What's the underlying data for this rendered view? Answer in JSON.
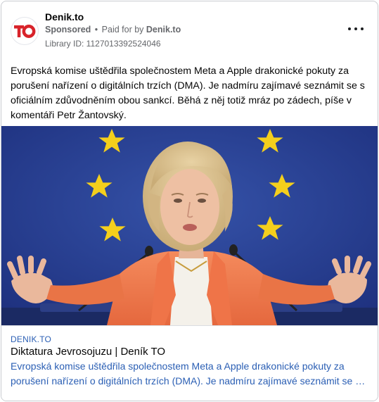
{
  "post": {
    "page_name": "Denik.to",
    "avatar_logo_text": "TO",
    "sponsored_label": "Sponsored",
    "separator": "•",
    "paid_for_prefix": "Paid for by",
    "paid_for_by": "Denik.to",
    "library_id": "Library ID: 1127013392524046",
    "text": "Evropská komise uštědřila společnostem Meta a Apple drakonické pokuty za porušení nařízení o digitálních trzích (DMA). Je nadmíru zajímavé seznámit se s oficiálním zdůvodněním obou sankcí. Běhá z něj totiž mráz po zádech, píše v komentáři Petr Žantovský."
  },
  "link_preview": {
    "domain": "DENIK.TO",
    "title": "Diktatura Jevrosojuzu | Deník TO",
    "description": "Evropská komise uštědřila společnostem Meta a Apple drakonické pokuty za porušení nařízení o digitálních trzích (DMA). Je nadmíru zajímavé seznámit se s oficiálním zdůvodněním obou sankcí."
  },
  "icons": {
    "avatar": "denik-to-logo",
    "more": "more-options-icon"
  },
  "colors": {
    "brand_red": "#d8232a",
    "link_blue": "#2b5fb4",
    "eu_blue": "#243a8c",
    "eu_star": "#f4cf1c",
    "jacket": "#f07a4f"
  }
}
